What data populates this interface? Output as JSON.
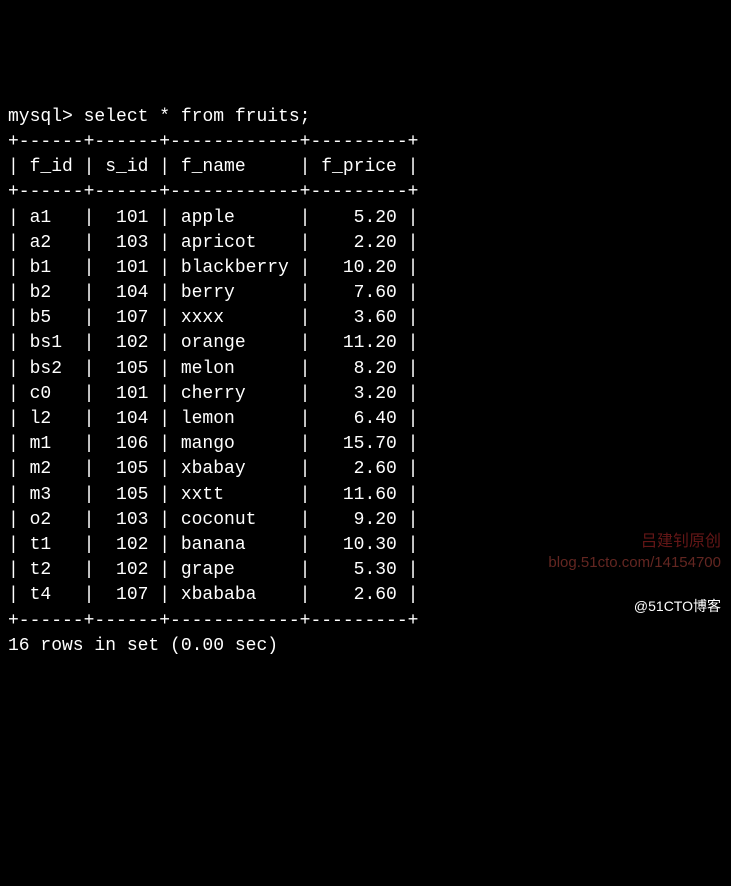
{
  "prompt": "mysql> ",
  "query": "select * from fruits;",
  "border_top": "+------+------+------------+---------+",
  "border_mid": "+------+------+------------+---------+",
  "border_bottom": "+------+------+------------+---------+",
  "columns": [
    "f_id",
    "s_id",
    "f_name",
    "f_price"
  ],
  "rows": [
    {
      "f_id": "a1",
      "s_id": "101",
      "f_name": "apple",
      "f_price": "5.20"
    },
    {
      "f_id": "a2",
      "s_id": "103",
      "f_name": "apricot",
      "f_price": "2.20"
    },
    {
      "f_id": "b1",
      "s_id": "101",
      "f_name": "blackberry",
      "f_price": "10.20"
    },
    {
      "f_id": "b2",
      "s_id": "104",
      "f_name": "berry",
      "f_price": "7.60"
    },
    {
      "f_id": "b5",
      "s_id": "107",
      "f_name": "xxxx",
      "f_price": "3.60"
    },
    {
      "f_id": "bs1",
      "s_id": "102",
      "f_name": "orange",
      "f_price": "11.20"
    },
    {
      "f_id": "bs2",
      "s_id": "105",
      "f_name": "melon",
      "f_price": "8.20"
    },
    {
      "f_id": "c0",
      "s_id": "101",
      "f_name": "cherry",
      "f_price": "3.20"
    },
    {
      "f_id": "l2",
      "s_id": "104",
      "f_name": "lemon",
      "f_price": "6.40"
    },
    {
      "f_id": "m1",
      "s_id": "106",
      "f_name": "mango",
      "f_price": "15.70"
    },
    {
      "f_id": "m2",
      "s_id": "105",
      "f_name": "xbabay",
      "f_price": "2.60"
    },
    {
      "f_id": "m3",
      "s_id": "105",
      "f_name": "xxtt",
      "f_price": "11.60"
    },
    {
      "f_id": "o2",
      "s_id": "103",
      "f_name": "coconut",
      "f_price": "9.20"
    },
    {
      "f_id": "t1",
      "s_id": "102",
      "f_name": "banana",
      "f_price": "10.30"
    },
    {
      "f_id": "t2",
      "s_id": "102",
      "f_name": "grape",
      "f_price": "5.30"
    },
    {
      "f_id": "t4",
      "s_id": "107",
      "f_name": "xbababa",
      "f_price": "2.60"
    }
  ],
  "summary": "16 rows in set (0.00 sec)",
  "watermark_red": "吕建钊原创",
  "watermark_url": "blog.51cto.com/14154700",
  "attribution": "@51CTO博客",
  "col_widths": {
    "f_id": 4,
    "s_id": 4,
    "f_name": 10,
    "f_price": 7
  }
}
